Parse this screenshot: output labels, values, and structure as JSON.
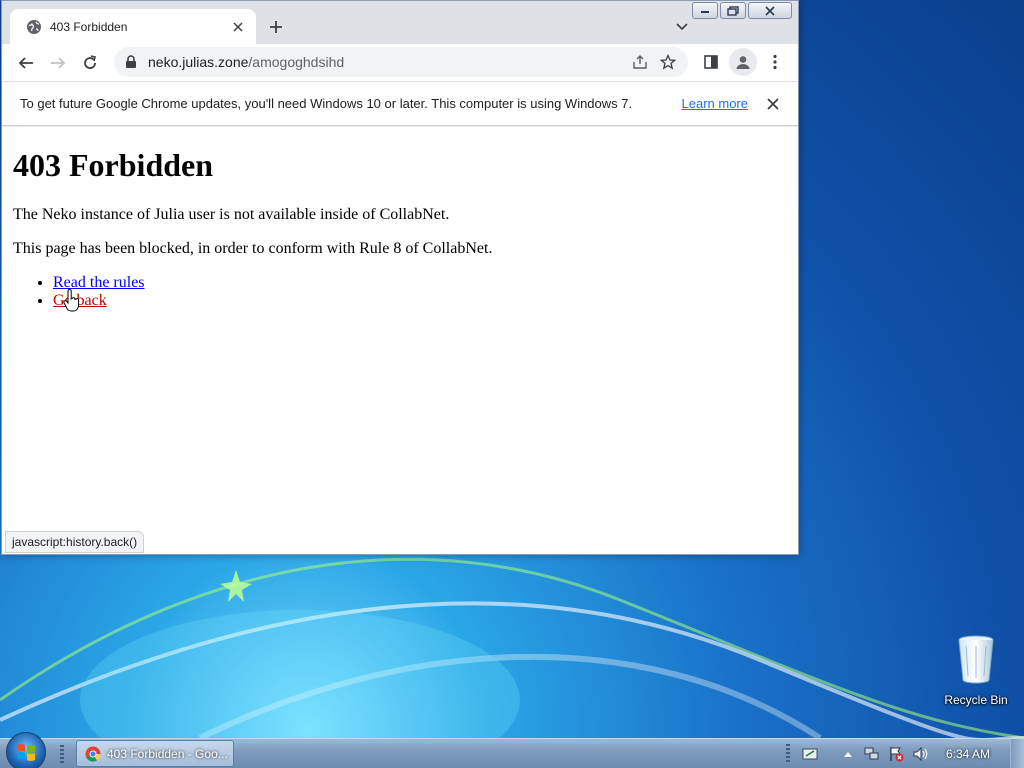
{
  "tab": {
    "title": "403 Forbidden",
    "icon": "globe-icon"
  },
  "omnibox": {
    "host": "neko.julias.zone",
    "path": "/amogoghdsihd"
  },
  "infobar": {
    "message": "To get future Google Chrome updates, you'll need Windows 10 or later. This computer is using Windows 7.",
    "link": "Learn more"
  },
  "page": {
    "heading": "403 Forbidden",
    "para1": "The Neko instance of Julia user is not available inside of CollabNet.",
    "para2": "This page has been blocked, in order to conform with Rule 8 of CollabNet.",
    "links": [
      {
        "label": "Read the rules",
        "color": "#0000ee"
      },
      {
        "label": "Go back",
        "color": "#c00000"
      }
    ]
  },
  "status_bubble": "javascript:history.back()",
  "desktop": {
    "recycle_bin": "Recycle Bin"
  },
  "taskbar": {
    "task_label": "403 Forbidden - Goo...",
    "clock": "6:34 AM"
  }
}
